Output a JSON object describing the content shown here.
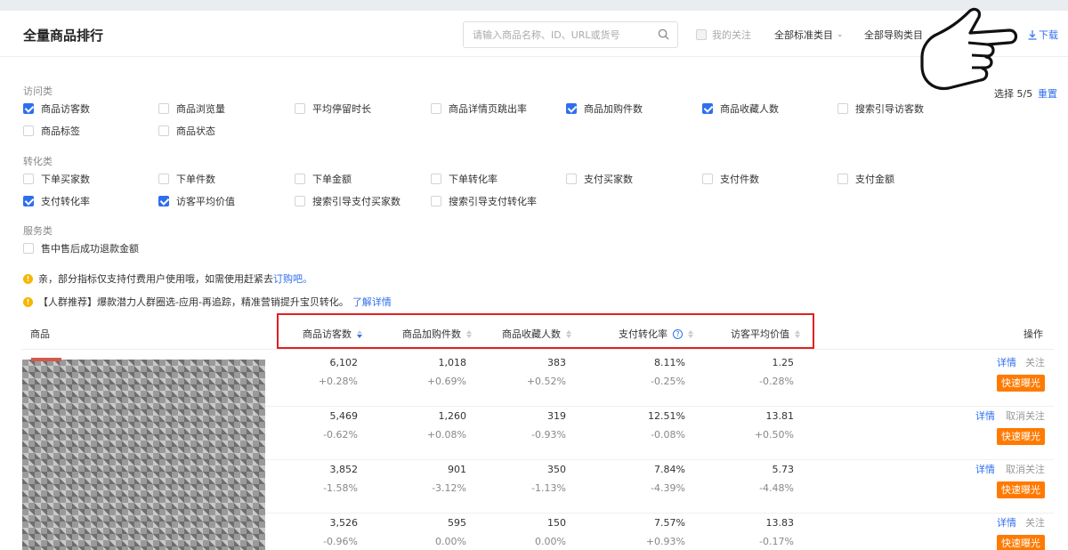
{
  "page": {
    "title": "全量商品排行"
  },
  "search": {
    "placeholder": "请输入商品名称、ID、URL或货号"
  },
  "header": {
    "follow_label": "我的关注",
    "dropdown1": "全部标准类目",
    "dropdown2": "全部导购类目",
    "download_label": "下载"
  },
  "selection": {
    "count_label": "选择 5/5",
    "reset_label": "重置"
  },
  "sections": {
    "visit": {
      "label": "访问类",
      "options": [
        {
          "label": "商品访客数",
          "checked": true
        },
        {
          "label": "商品浏览量",
          "checked": false
        },
        {
          "label": "平均停留时长",
          "checked": false
        },
        {
          "label": "商品详情页跳出率",
          "checked": false
        },
        {
          "label": "商品加购件数",
          "checked": true
        },
        {
          "label": "商品收藏人数",
          "checked": true
        },
        {
          "label": "搜索引导访客数",
          "checked": false
        },
        {
          "label": "商品标签",
          "checked": false
        },
        {
          "label": "商品状态",
          "checked": false
        }
      ]
    },
    "conversion": {
      "label": "转化类",
      "options": [
        {
          "label": "下单买家数",
          "checked": false
        },
        {
          "label": "下单件数",
          "checked": false
        },
        {
          "label": "下单金额",
          "checked": false
        },
        {
          "label": "下单转化率",
          "checked": false
        },
        {
          "label": "支付买家数",
          "checked": false
        },
        {
          "label": "支付件数",
          "checked": false
        },
        {
          "label": "支付金额",
          "checked": false
        },
        {
          "label": "支付转化率",
          "checked": true
        },
        {
          "label": "访客平均价值",
          "checked": true
        },
        {
          "label": "搜索引导支付买家数",
          "checked": false
        },
        {
          "label": "搜索引导支付转化率",
          "checked": false
        }
      ]
    },
    "service": {
      "label": "服务类",
      "options": [
        {
          "label": "售中售后成功退款金额",
          "checked": false
        }
      ]
    }
  },
  "notices": {
    "n1_text": "亲，部分指标仅支持付费用户使用哦，如需使用赶紧去",
    "n1_link": "订购吧。",
    "n2_text": "【人群推荐】爆款潜力人群圈选-应用-再追踪，精准营销提升宝贝转化。",
    "n2_link": "了解详情"
  },
  "table": {
    "columns": {
      "product": "商品",
      "visitors": "商品访客数",
      "cart": "商品加购件数",
      "fav": "商品收藏人数",
      "conv": "支付转化率",
      "value": "访客平均价值",
      "ops": "操作"
    },
    "rows": [
      {
        "visitors": "6,102",
        "visitors_d": "+0.28%",
        "cart": "1,018",
        "cart_d": "+0.69%",
        "fav": "383",
        "fav_d": "+0.52%",
        "conv": "8.11%",
        "conv_d": "-0.25%",
        "value": "1.25",
        "value_d": "-0.28%",
        "detail": "详情",
        "follow": "关注",
        "expose": "快速曝光"
      },
      {
        "visitors": "5,469",
        "visitors_d": "-0.62%",
        "cart": "1,260",
        "cart_d": "+0.08%",
        "fav": "319",
        "fav_d": "-0.93%",
        "conv": "12.51%",
        "conv_d": "-0.08%",
        "value": "13.81",
        "value_d": "+0.50%",
        "detail": "详情",
        "follow": "取消关注",
        "expose": "快速曝光"
      },
      {
        "visitors": "3,852",
        "visitors_d": "-1.58%",
        "cart": "901",
        "cart_d": "-3.12%",
        "fav": "350",
        "fav_d": "-1.13%",
        "conv": "7.84%",
        "conv_d": "-4.39%",
        "value": "5.73",
        "value_d": "-4.48%",
        "detail": "详情",
        "follow": "取消关注",
        "expose": "快速曝光"
      },
      {
        "visitors": "3,526",
        "visitors_d": "-0.96%",
        "cart": "595",
        "cart_d": "0.00%",
        "fav": "150",
        "fav_d": "0.00%",
        "conv": "7.57%",
        "conv_d": "+0.93%",
        "value": "13.83",
        "value_d": "-0.17%",
        "detail": "详情",
        "follow": "关注",
        "expose": "快速曝光"
      }
    ]
  },
  "colors": {
    "accent": "#2f6fed",
    "expose": "#ff7a00",
    "highlight_frame": "#e02020"
  }
}
